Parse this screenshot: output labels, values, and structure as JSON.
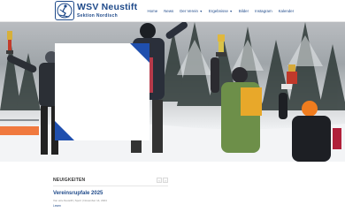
{
  "brand": {
    "title": "WSV Neustift",
    "subtitle": "Sektion Nordisch",
    "primary_color": "#1f4a8a",
    "accent_color": "#1f4fae"
  },
  "nav": {
    "items": [
      {
        "label": "Home",
        "has_dropdown": false
      },
      {
        "label": "News",
        "has_dropdown": false
      },
      {
        "label": "Der Verein",
        "has_dropdown": true
      },
      {
        "label": "Ergebnisse",
        "has_dropdown": true
      },
      {
        "label": "Bilder",
        "has_dropdown": false
      },
      {
        "label": "Instagram",
        "has_dropdown": false
      },
      {
        "label": "Kalender",
        "has_dropdown": false
      }
    ]
  },
  "hero": {
    "image_description_icon": "photo-icon"
  },
  "news": {
    "section_label": "NEUIGKEITEN",
    "prev_icon": "chevron-left-icon",
    "next_icon": "chevron-right-icon",
    "article": {
      "title": "Vereinsrupfale 2025",
      "meta": "Von wsv-Neustift | Sport | November 14, 2024",
      "link": "Lesen"
    }
  }
}
